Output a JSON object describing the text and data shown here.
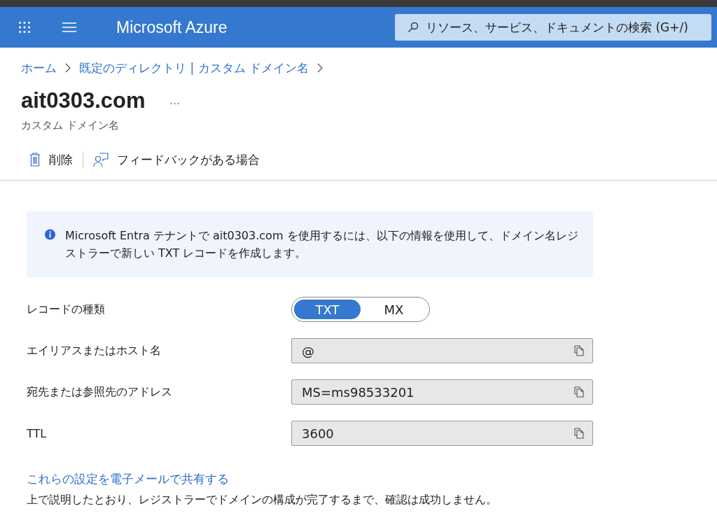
{
  "header": {
    "title": "Microsoft Azure",
    "search": {
      "placeholder": "リソース、サービス、ドキュメントの検索 (G+/)"
    }
  },
  "breadcrumb": [
    "ホーム",
    "既定のディレクトリ | カスタム ドメイン名"
  ],
  "page": {
    "title": "ait0303.com",
    "more": "…",
    "subtitle": "カスタム ドメイン名"
  },
  "toolbar": [
    {
      "kind": "delete",
      "label": "削除"
    },
    {
      "kind": "feedback",
      "label": "フィードバックがある場合"
    }
  ],
  "info": {
    "text": "Microsoft Entra テナントで ait0303.com を使用するには、以下の情報を使用して、ドメイン名レジストラーで新しい TXT レコードを作成します。"
  },
  "record_type": {
    "label": "レコードの種類",
    "options": [
      {
        "label": "TXT",
        "selected": true
      },
      {
        "label": "MX",
        "selected": false
      }
    ]
  },
  "fields": [
    {
      "label": "エイリアスまたはホスト名",
      "value": "@"
    },
    {
      "label": "宛先または参照先のアドレス",
      "value": "MS=ms98533201"
    },
    {
      "label": "TTL",
      "value": "3600"
    }
  ],
  "share_link": "これらの設定を電子メールで共有する",
  "note": "上で説明したとおり、レジストラーでドメインの構成が完了するまで、確認は成功しません。"
}
